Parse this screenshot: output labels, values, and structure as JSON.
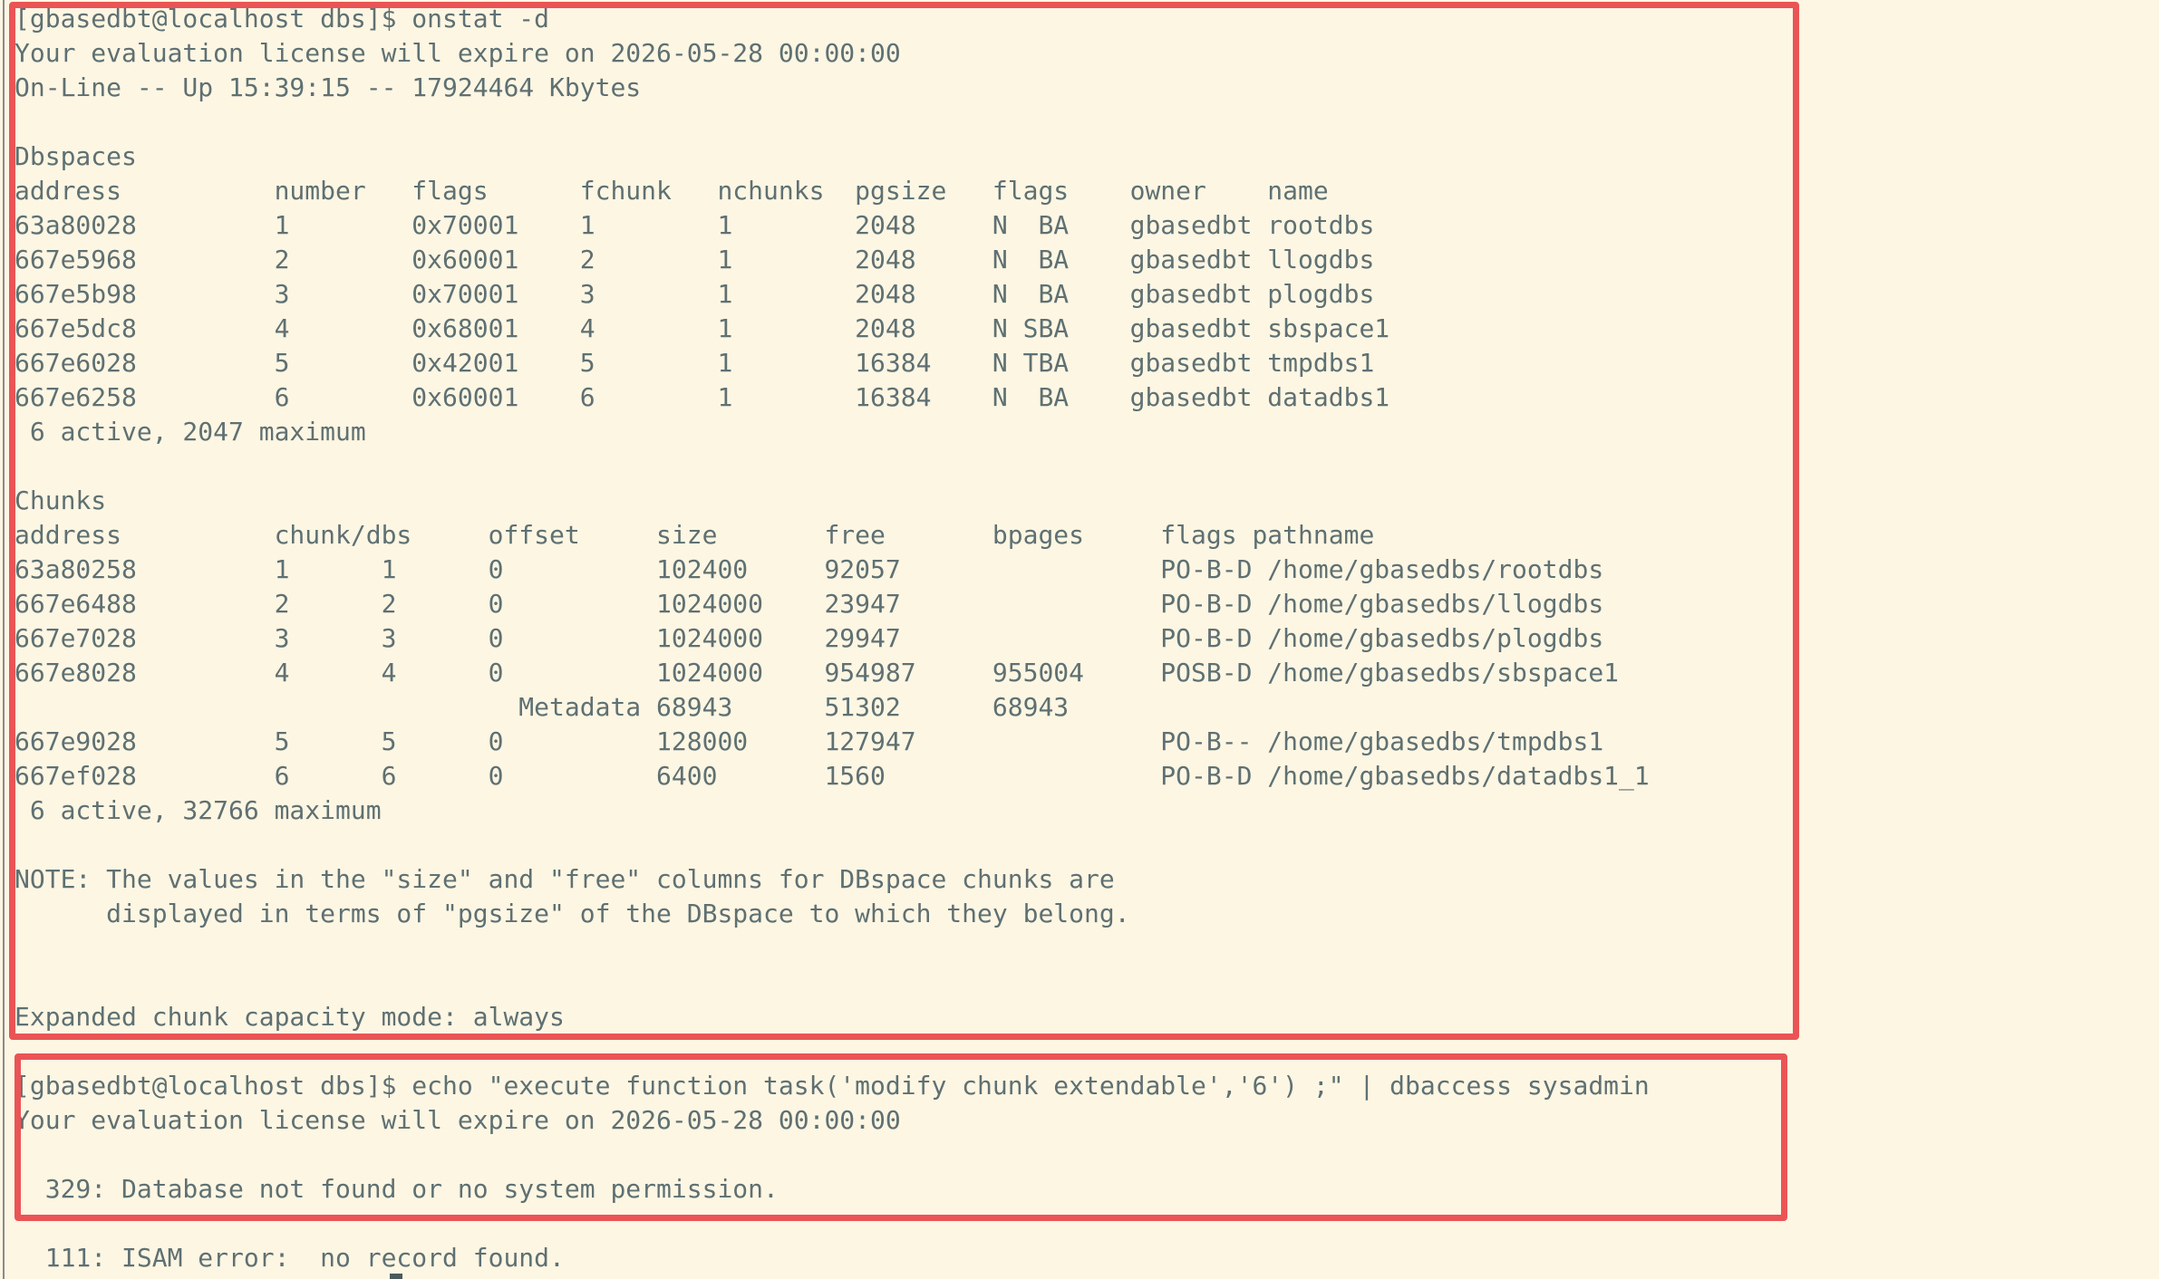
{
  "colors": {
    "background": "#fdf6e3",
    "text": "#5f7072",
    "highlight_border": "#ea5455"
  },
  "terminal": {
    "lines": [
      "[gbasedbt@localhost dbs]$ onstat -d",
      "Your evaluation license will expire on 2026-05-28 00:00:00",
      "On-Line -- Up 15:39:15 -- 17924464 Kbytes",
      "",
      "Dbspaces",
      "address          number   flags      fchunk   nchunks  pgsize   flags    owner    name",
      "63a80028         1        0x70001    1        1        2048     N  BA    gbasedbt rootdbs",
      "667e5968         2        0x60001    2        1        2048     N  BA    gbasedbt llogdbs",
      "667e5b98         3        0x70001    3        1        2048     N  BA    gbasedbt plogdbs",
      "667e5dc8         4        0x68001    4        1        2048     N SBA    gbasedbt sbspace1",
      "667e6028         5        0x42001    5        1        16384    N TBA    gbasedbt tmpdbs1",
      "667e6258         6        0x60001    6        1        16384    N  BA    gbasedbt datadbs1",
      " 6 active, 2047 maximum",
      "",
      "Chunks",
      "address          chunk/dbs     offset     size       free       bpages     flags pathname",
      "63a80258         1      1      0          102400     92057                 PO-B-D /home/gbasedbs/rootdbs",
      "667e6488         2      2      0          1024000    23947                 PO-B-D /home/gbasedbs/llogdbs",
      "667e7028         3      3      0          1024000    29947                 PO-B-D /home/gbasedbs/plogdbs",
      "667e8028         4      4      0          1024000    954987     955004     POSB-D /home/gbasedbs/sbspace1",
      "                                 Metadata 68943      51302      68943",
      "667e9028         5      5      0          128000     127947                PO-B-- /home/gbasedbs/tmpdbs1",
      "667ef028         6      6      0          6400       1560                  PO-B-D /home/gbasedbs/datadbs1_1",
      " 6 active, 32766 maximum",
      "",
      "NOTE: The values in the \"size\" and \"free\" columns for DBspace chunks are",
      "      displayed in terms of \"pgsize\" of the DBspace to which they belong.",
      "",
      "",
      "Expanded chunk capacity mode: always",
      "",
      "[gbasedbt@localhost dbs]$ echo \"execute function task('modify chunk extendable','6') ;\" | dbaccess sysadmin",
      "Your evaluation license will expire on 2026-05-28 00:00:00",
      "",
      "  329: Database not found or no system permission.",
      "",
      "  111: ISAM error:  no record found."
    ]
  }
}
